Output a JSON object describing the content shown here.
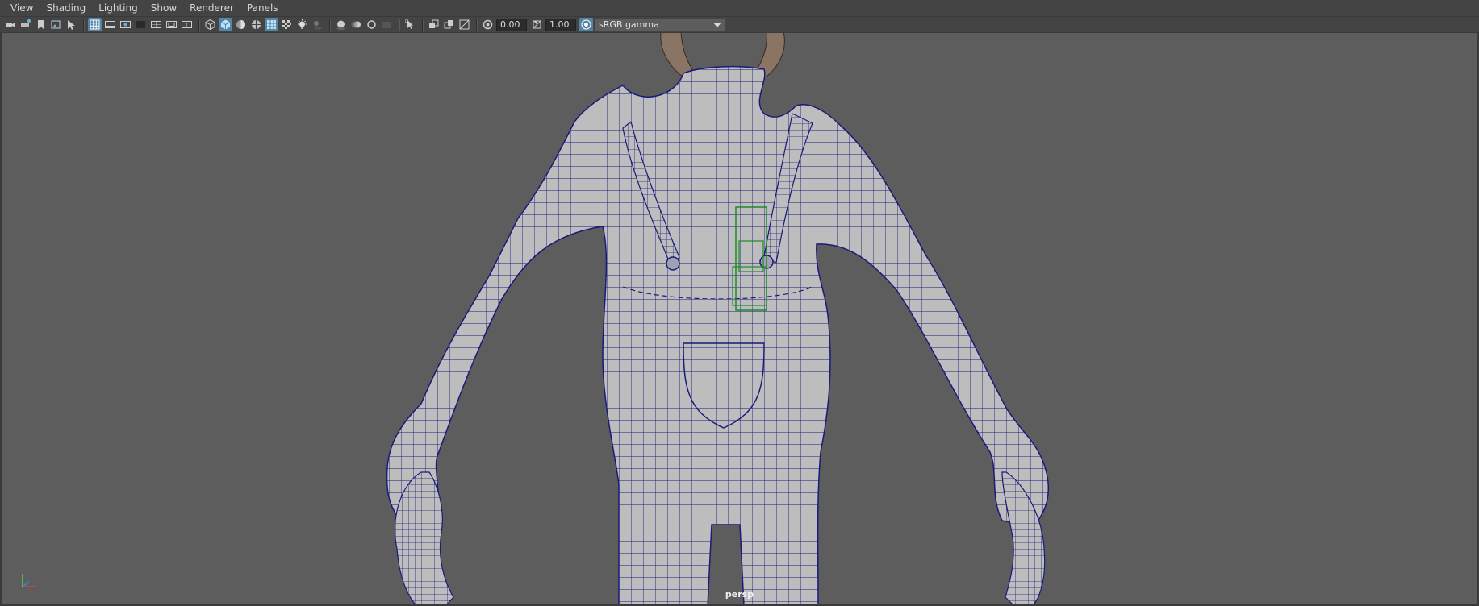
{
  "menu": {
    "items": [
      "View",
      "Shading",
      "Lighting",
      "Show",
      "Renderer",
      "Panels"
    ]
  },
  "toolbar": {
    "exposure_value": "0.00",
    "gamma_value": "1.00",
    "color_management": "sRGB gamma",
    "icons": [
      "select-camera-icon",
      "camera-attributes-icon",
      "bookmark-icon",
      "image-plane-icon",
      "grid-icon",
      "film-gate-icon",
      "resolution-gate-icon",
      "gate-mask-icon",
      "field-chart-icon",
      "safe-action-icon",
      "safe-title-icon",
      "wireframe-icon",
      "smooth-shade-icon",
      "default-material-icon",
      "wireframe-on-shaded-icon",
      "textured-icon",
      "use-all-lights-icon",
      "shadows-icon",
      "screen-space-ao-icon",
      "motion-blur-icon",
      "anti-aliasing-icon",
      "isolate-select-icon",
      "xray-icon",
      "xray-joints-icon",
      "xray-active-icon",
      "exposure-icon",
      "gamma-icon",
      "color-management-icon"
    ]
  },
  "viewport": {
    "camera": "persp",
    "wire_color": "#1a1a7a",
    "mesh_color": "#bdbdbd",
    "background": "#5d5d5d",
    "locator_color": "#1f8a2a"
  }
}
